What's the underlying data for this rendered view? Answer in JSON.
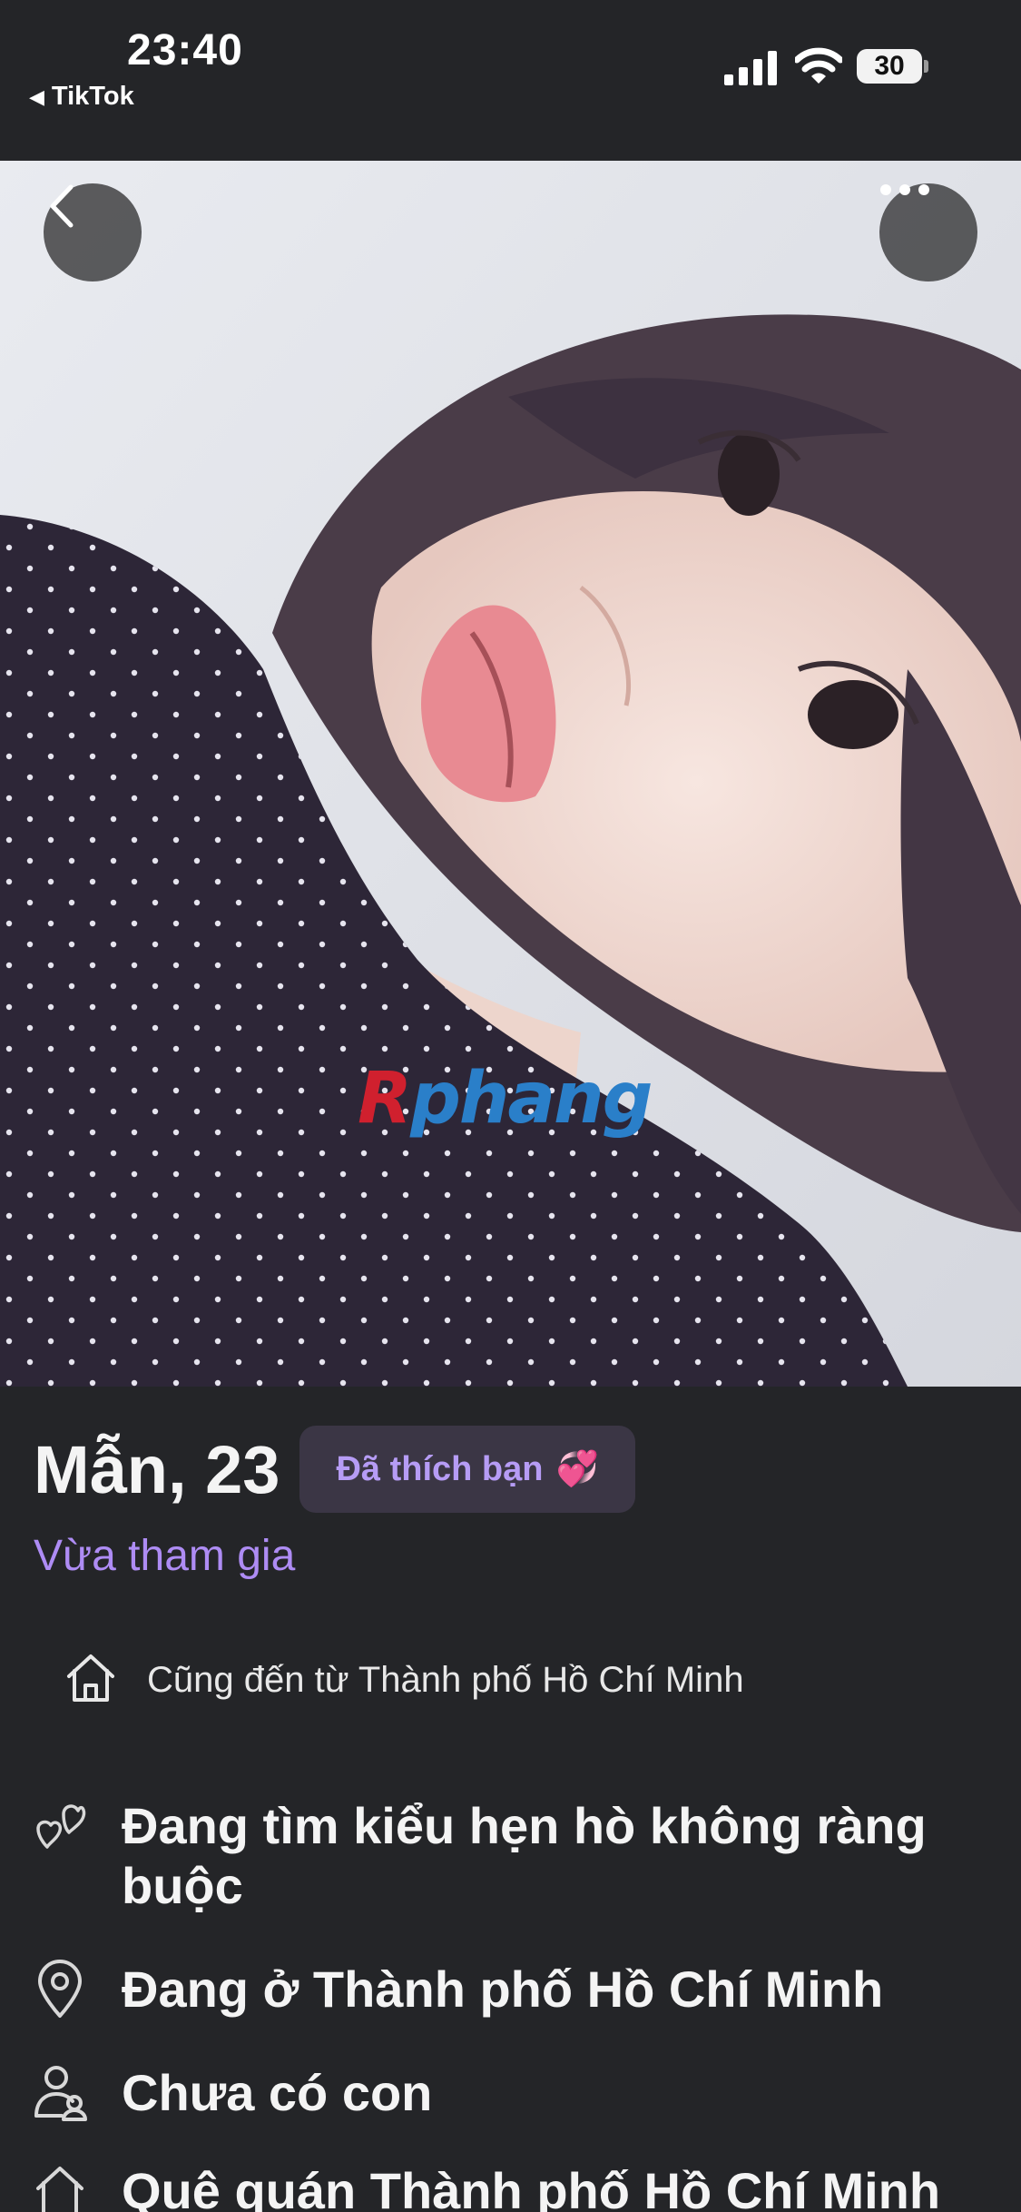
{
  "status_bar": {
    "time": "23:40",
    "back_app": "TikTok",
    "battery": "30",
    "icons": [
      "cellular-signal-icon",
      "wifi-icon",
      "battery-icon"
    ]
  },
  "photo": {
    "watermark_part1": "R",
    "watermark_part2": "phang",
    "icons": [
      "chevron-left-icon",
      "more-horizontal-icon"
    ]
  },
  "profile": {
    "name_age": "Mẫn, 23",
    "liked_badge": "Đã thích bạn",
    "liked_emoji": "💞",
    "joined": "Vừa tham gia",
    "same_hometown": "Cũng đến từ Thành phố Hồ Chí Minh",
    "details": [
      {
        "icon": "hearts-icon",
        "text": "Đang tìm kiểu hẹn hò không ràng buộc"
      },
      {
        "icon": "location-pin-icon",
        "text": "Đang ở Thành phố Hồ Chí Minh"
      },
      {
        "icon": "people-icon",
        "text": "Chưa có con"
      },
      {
        "icon": "home-icon",
        "text": "Quê quán Thành phố Hồ Chí Minh"
      }
    ]
  },
  "colors": {
    "background": "#242528",
    "accent_purple": "#ae8cf4",
    "badge_bg": "#3b3645",
    "badge_text": "#b69cf5"
  }
}
